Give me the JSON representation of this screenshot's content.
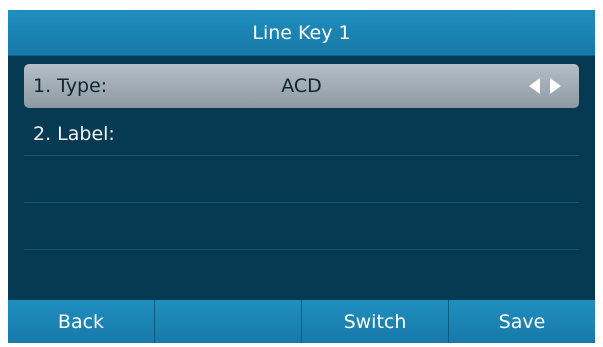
{
  "title": "Line Key 1",
  "fields": [
    {
      "label": "1. Type:",
      "value": "ACD"
    },
    {
      "label": "2. Label:",
      "value": ""
    }
  ],
  "softkeys": [
    "Back",
    "",
    "Switch",
    "Save"
  ],
  "colors": {
    "screen_background": "#063a52",
    "bar_blue": "#1a84b4",
    "selected_row": "#a3aeb6"
  }
}
